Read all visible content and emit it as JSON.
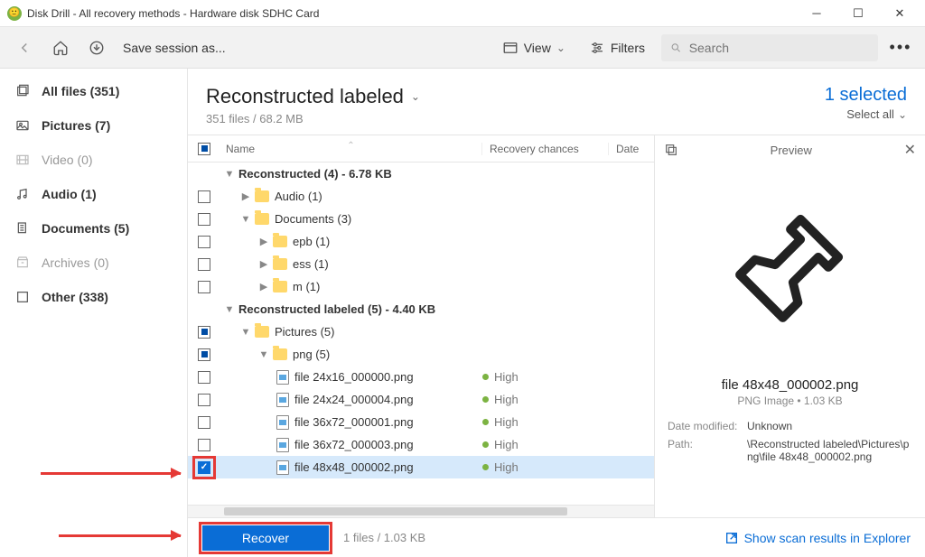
{
  "window": {
    "title": "Disk Drill - All recovery methods - Hardware disk SDHC Card"
  },
  "toolbar": {
    "save_session": "Save session as...",
    "view": "View",
    "filters": "Filters",
    "search_placeholder": "Search"
  },
  "sidebar": {
    "items": [
      {
        "label": "All files (351)",
        "kind": "all",
        "bold": true
      },
      {
        "label": "Pictures (7)",
        "kind": "pictures",
        "bold": true
      },
      {
        "label": "Video (0)",
        "kind": "video",
        "muted": true
      },
      {
        "label": "Audio (1)",
        "kind": "audio",
        "bold": true
      },
      {
        "label": "Documents (5)",
        "kind": "documents",
        "bold": true
      },
      {
        "label": "Archives (0)",
        "kind": "archives",
        "muted": true
      },
      {
        "label": "Other (338)",
        "kind": "other",
        "bold": true
      }
    ]
  },
  "header": {
    "title": "Reconstructed labeled",
    "subtitle": "351 files / 68.2 MB",
    "selected": "1 selected",
    "select_all": "Select all"
  },
  "columns": {
    "name": "Name",
    "recovery": "Recovery chances",
    "date": "Date"
  },
  "groups": [
    {
      "label": "Reconstructed (4) - 6.78 KB"
    },
    {
      "label": "Reconstructed labeled (5) - 4.40 KB"
    }
  ],
  "folders": {
    "audio": "Audio (1)",
    "documents": "Documents (3)",
    "epb": "epb (1)",
    "ess": "ess (1)",
    "m": "m (1)",
    "pictures": "Pictures (5)",
    "png": "png (5)"
  },
  "files": [
    {
      "name": "file 24x16_000000.png",
      "rc": "High"
    },
    {
      "name": "file 24x24_000004.png",
      "rc": "High"
    },
    {
      "name": "file 36x72_000001.png",
      "rc": "High"
    },
    {
      "name": "file 36x72_000003.png",
      "rc": "High"
    },
    {
      "name": "file 48x48_000002.png",
      "rc": "High"
    }
  ],
  "preview": {
    "title": "Preview",
    "filename": "file 48x48_000002.png",
    "subtitle": "PNG Image • 1.03 KB",
    "date_modified_k": "Date modified:",
    "date_modified_v": "Unknown",
    "path_k": "Path:",
    "path_v": "\\Reconstructed labeled\\Pictures\\png\\file 48x48_000002.png"
  },
  "footer": {
    "recover": "Recover",
    "info": "1 files / 1.03 KB",
    "explorer": "Show scan results in Explorer"
  }
}
